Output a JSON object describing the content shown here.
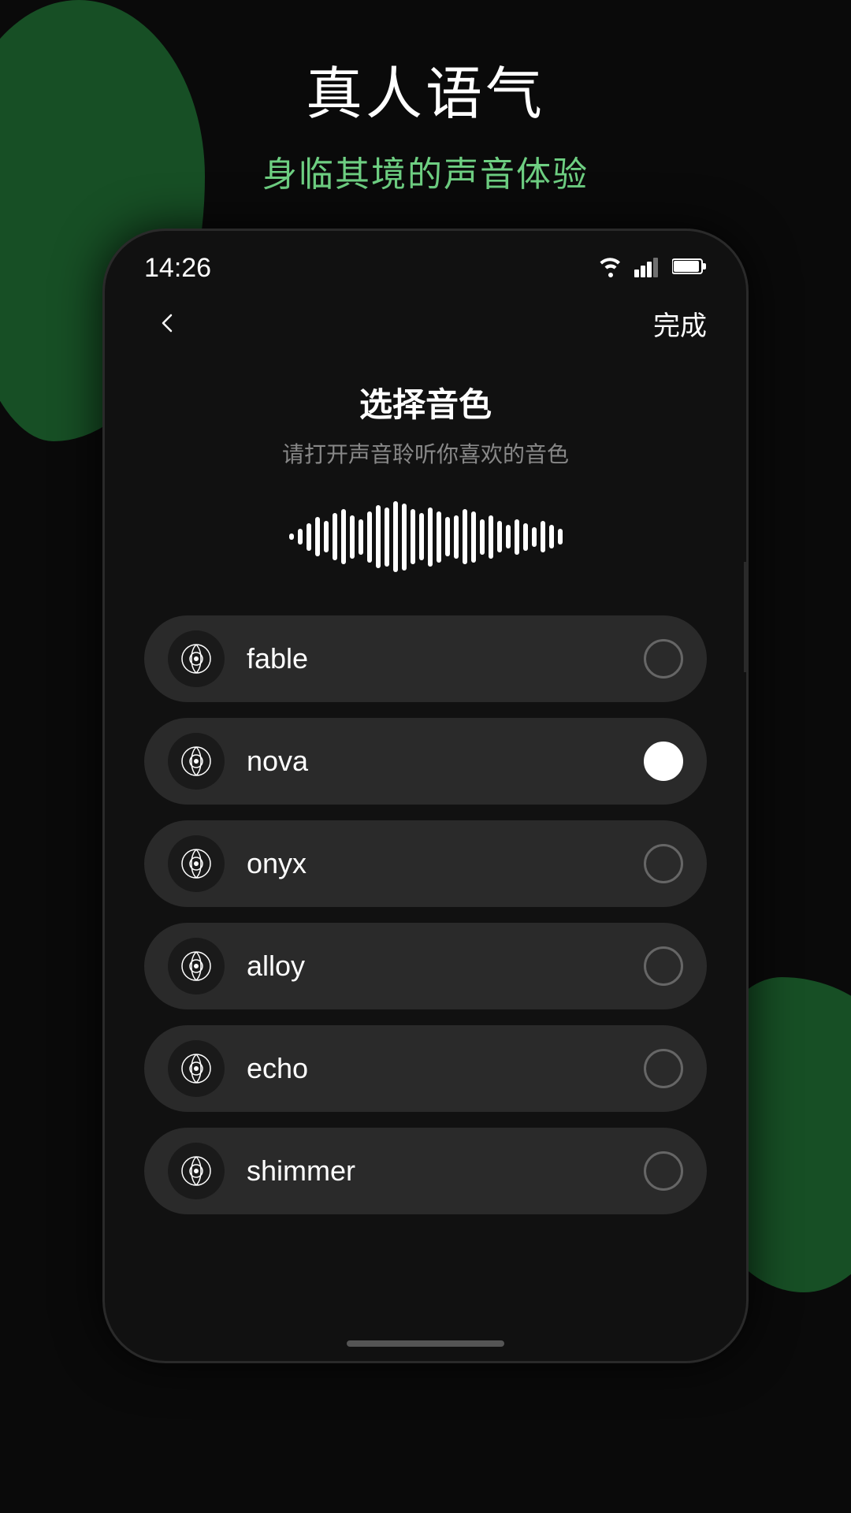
{
  "background": {
    "color": "#0a0a0a",
    "accent_color": "#1a5c2a"
  },
  "header": {
    "title": "真人语气",
    "subtitle": "身临其境的声音体验"
  },
  "status_bar": {
    "time": "14:26"
  },
  "nav": {
    "back_label": "←",
    "done_label": "完成"
  },
  "page": {
    "title": "选择音色",
    "subtitle": "请打开声音聆听你喜欢的音色"
  },
  "waveform": {
    "bars": [
      8,
      20,
      35,
      50,
      40,
      60,
      70,
      55,
      45,
      65,
      80,
      75,
      90,
      85,
      70,
      60,
      75,
      65,
      50,
      55,
      70,
      65,
      45,
      55,
      40,
      30,
      45,
      35,
      25,
      40,
      30,
      20
    ]
  },
  "voice_options": [
    {
      "id": "fable",
      "name": "fable",
      "selected": false
    },
    {
      "id": "nova",
      "name": "nova",
      "selected": true
    },
    {
      "id": "onyx",
      "name": "onyx",
      "selected": false
    },
    {
      "id": "alloy",
      "name": "alloy",
      "selected": false
    },
    {
      "id": "echo",
      "name": "echo",
      "selected": false
    },
    {
      "id": "shimmer",
      "name": "shimmer",
      "selected": false
    }
  ]
}
